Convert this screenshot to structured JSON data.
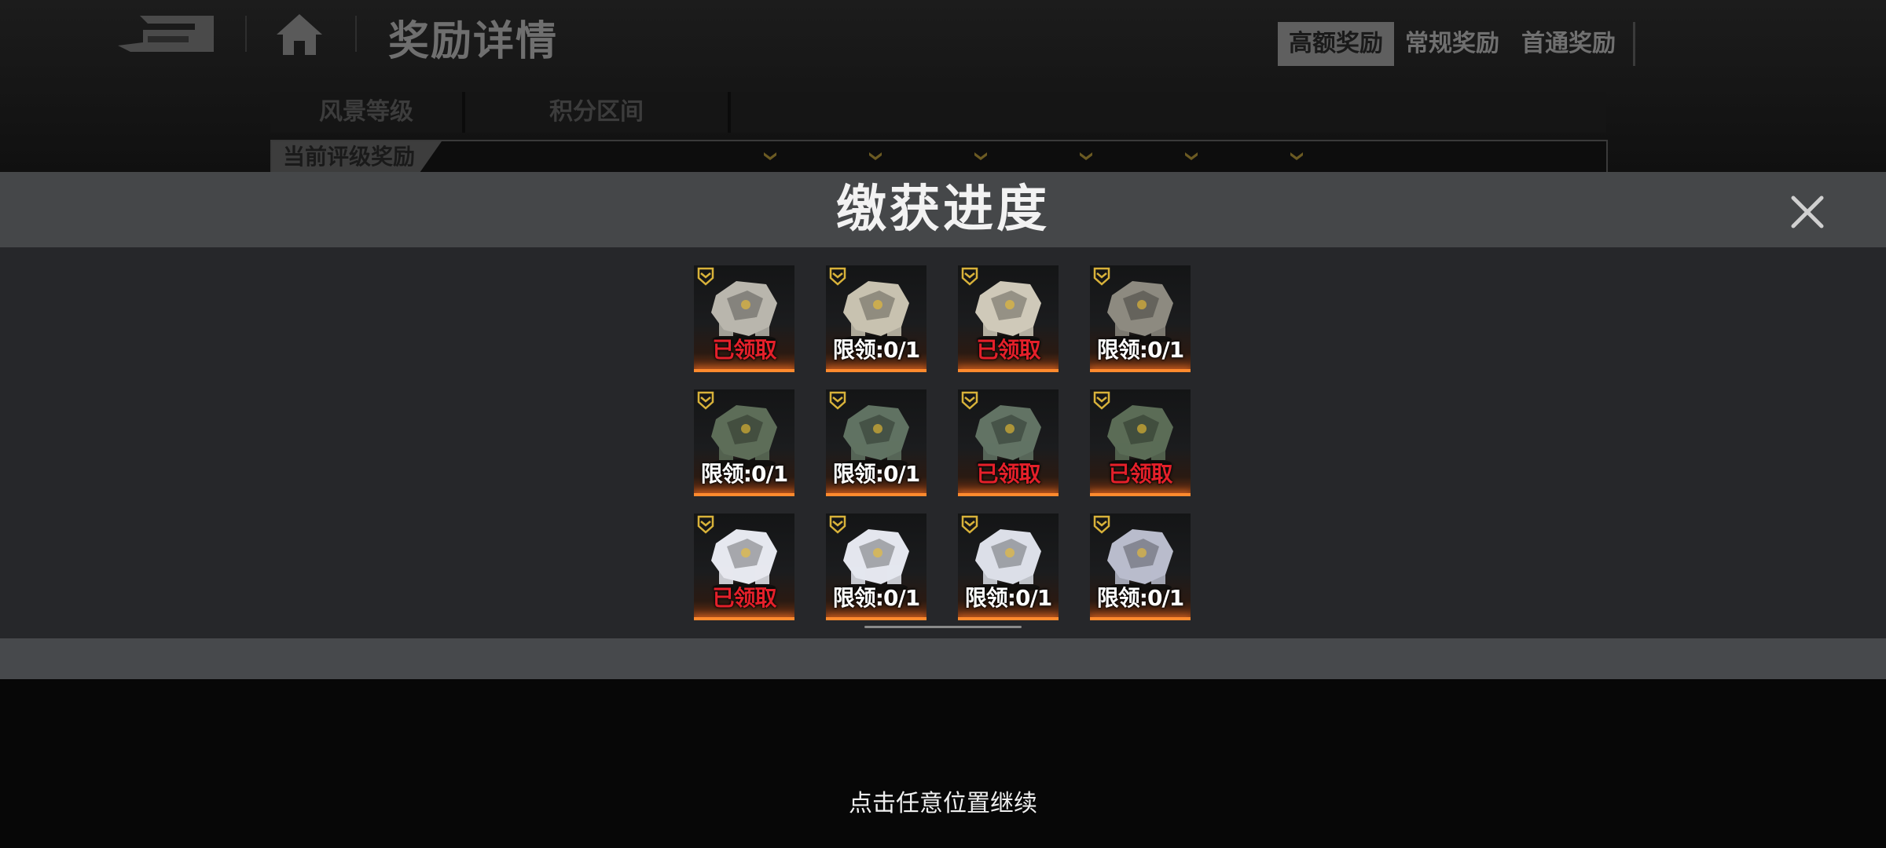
{
  "background_page": {
    "title": "奖励详情",
    "tabs": [
      {
        "label": "高额奖励",
        "active": true
      },
      {
        "label": "常规奖励",
        "active": false
      },
      {
        "label": "首通奖励",
        "active": false
      }
    ],
    "filters": [
      "风景等级",
      "积分区间"
    ],
    "section_label": "当前评级奖励"
  },
  "modal": {
    "title": "缴获进度",
    "close_icon": "close-x-icon",
    "items": [
      {
        "status": "已领取",
        "claimed": true,
        "color": "#b9b6ad"
      },
      {
        "status": "限领:0/1",
        "claimed": false,
        "color": "#c8c2b0"
      },
      {
        "status": "已领取",
        "claimed": true,
        "color": "#cfc9b9"
      },
      {
        "status": "限领:0/1",
        "claimed": false,
        "color": "#8d8a80"
      },
      {
        "status": "限领:0/1",
        "claimed": false,
        "color": "#5d6d58"
      },
      {
        "status": "限领:0/1",
        "claimed": false,
        "color": "#607262"
      },
      {
        "status": "已领取",
        "claimed": true,
        "color": "#627364"
      },
      {
        "status": "已领取",
        "claimed": true,
        "color": "#5b6c56"
      },
      {
        "status": "已领取",
        "claimed": true,
        "color": "#e6e8ef"
      },
      {
        "status": "限领:0/1",
        "claimed": false,
        "color": "#e4e6ee"
      },
      {
        "status": "限领:0/1",
        "claimed": false,
        "color": "#dcdfe8"
      },
      {
        "status": "限领:0/1",
        "claimed": false,
        "color": "#b9bccc"
      }
    ]
  },
  "continue_hint": "点击任意位置继续",
  "colors": {
    "accent_orange": "#ff8a2e",
    "claimed_red": "#e4202a",
    "rank_gold": "#d8b23a"
  }
}
